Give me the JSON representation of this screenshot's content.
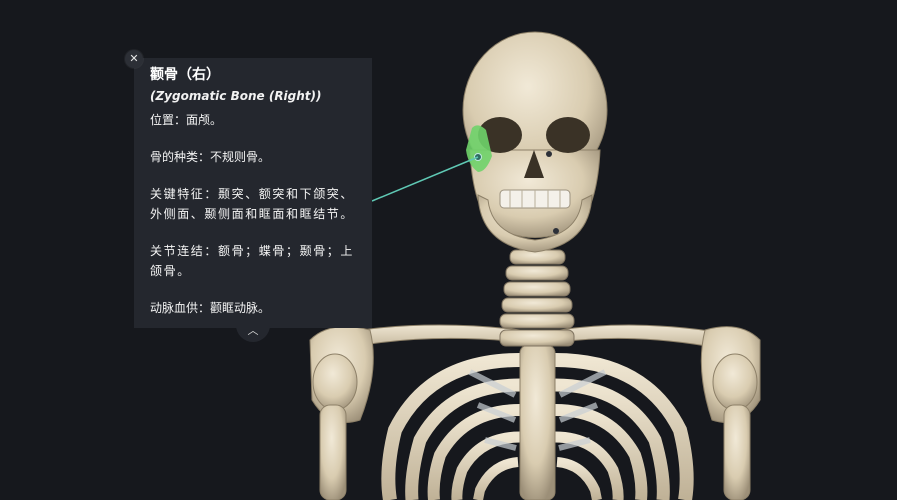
{
  "info_panel": {
    "title": "颧骨（右）",
    "subtitle": "(Zygomatic Bone (Right))",
    "location": "位置：面颅。",
    "bone_type": "骨的种类：不规则骨。",
    "key_features": "关键特征：颞突、额突和下颌突、外侧面、颞侧面和眶面和眶结节。",
    "articulations": "关节连结：额骨；蝶骨；颞骨；上颌骨。",
    "arterial_supply": "动脉血供：颧眶动脉。"
  },
  "icons": {
    "close": "close-icon",
    "collapse": "chevron-up-icon"
  },
  "colors": {
    "background": "#16181d",
    "panel": "#24272e",
    "highlight_bone": "#6fd36a",
    "leader_line": "#5fc8b4",
    "bone": "#e4d9c2"
  }
}
